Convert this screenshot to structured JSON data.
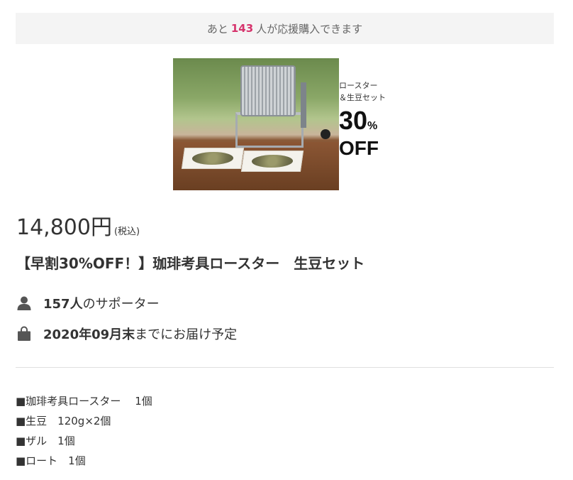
{
  "remaining": {
    "prefix": "あと",
    "count": "143",
    "suffix": "人が応援購入できます"
  },
  "image": {
    "promo_line1": "ロースター",
    "promo_line2": "＆生豆セット",
    "promo_percent": "30",
    "promo_percent_sign": "%",
    "promo_off": "OFF"
  },
  "price": {
    "amount": "14,800円",
    "tax": "(税込)"
  },
  "product": {
    "title": "【早割30%OFF！】珈琲考具ロースター　生豆セット"
  },
  "supporters": {
    "icon": "person-icon",
    "count": "157人",
    "label": "のサポーター"
  },
  "delivery": {
    "icon": "shopping-bag-icon",
    "date": "2020年09月末",
    "label": "までにお届け予定"
  },
  "contents": {
    "items": [
      "■珈琲考具ロースター　 1個",
      "■生豆　120g×2個",
      "■ザル　1個",
      "■ロート　1個"
    ]
  },
  "colors": {
    "accent": "#d6336c",
    "bar_bg": "#f4f4f4",
    "text": "#333333"
  }
}
